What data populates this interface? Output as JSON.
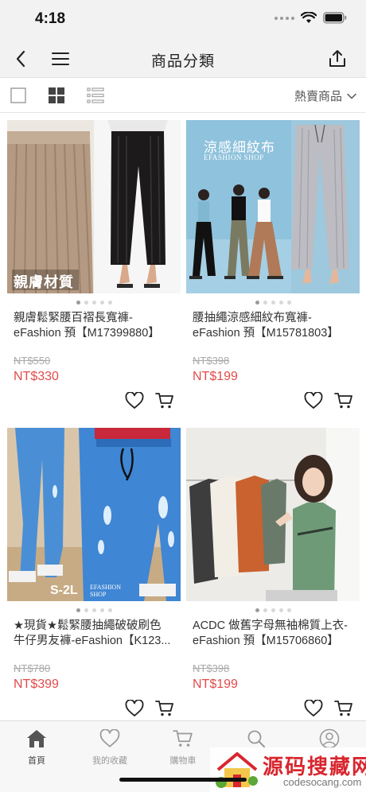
{
  "status": {
    "time": "4:18"
  },
  "nav": {
    "title": "商品分類"
  },
  "toolbar": {
    "sort_label": "熱賣商品"
  },
  "products": [
    {
      "image_caption": "親膚材質",
      "title_line1": "親膚鬆緊腰百褶長寬褲-",
      "title_line2": "eFashion 預【M17399880】",
      "original_price": "NT$550",
      "sale_price": "NT$330"
    },
    {
      "image_caption": "涼感細紋布",
      "image_brand": "EFASHION SHOP",
      "title_line1": "腰抽繩涼感細紋布寬褲-",
      "title_line2": "eFashion 預【M15781803】",
      "original_price": "NT$398",
      "sale_price": "NT$199"
    },
    {
      "image_caption": "S-2L",
      "image_brand": "EFASHION SHOP",
      "title_line1": "★現貨★鬆緊腰抽繩破破刷色",
      "title_line2": "牛仔男友褲-eFashion【K123...",
      "original_price": "NT$780",
      "sale_price": "NT$399"
    },
    {
      "image_caption": "",
      "title_line1": "ACDC 做舊字母無袖棉質上衣-",
      "title_line2": "eFashion 預【M15706860】",
      "original_price": "NT$398",
      "sale_price": "NT$199"
    }
  ],
  "tabs": [
    {
      "label": "首頁",
      "icon": "home-icon"
    },
    {
      "label": "我的收藏",
      "icon": "heart-icon"
    },
    {
      "label": "購物車",
      "icon": "cart-icon"
    },
    {
      "label": "",
      "icon": "search-icon"
    },
    {
      "label": "",
      "icon": "profile-icon"
    }
  ],
  "watermark": {
    "title": "源码搜藏网",
    "url": "codesocang.com"
  },
  "colors": {
    "price_red": "#e14b4b",
    "header_gray": "#f2f2f2",
    "watermark_red": "#d8262e"
  }
}
